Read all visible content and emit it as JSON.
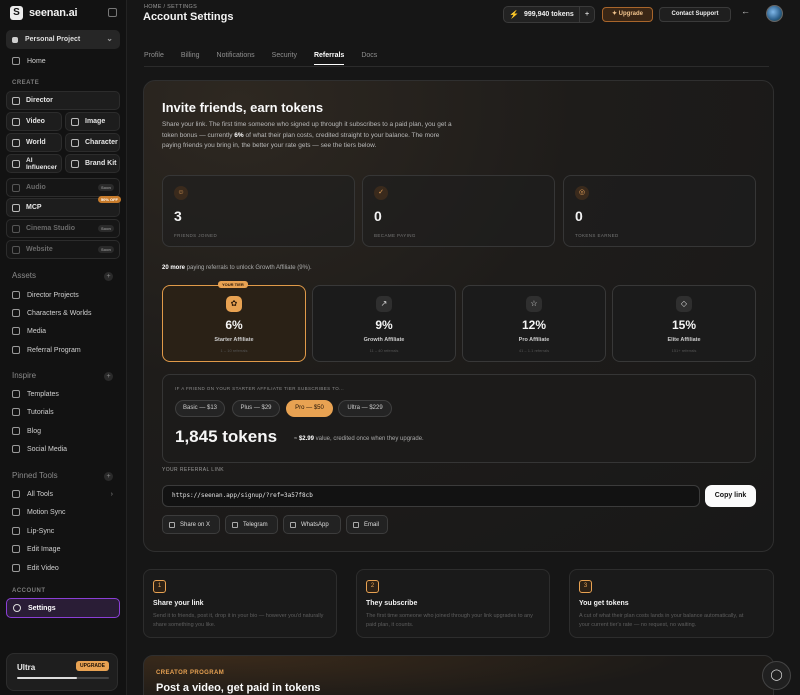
{
  "app": {
    "name": "seenan.ai"
  },
  "sidebar": {
    "project": "Personal Project",
    "home": "Home",
    "create_label": "CREATE",
    "tools": {
      "director": "Director",
      "video": "Video",
      "image": "Image",
      "world": "World",
      "character": "Character",
      "ai_influencer": "AI Influencer",
      "brand_kit": "Brand Kit",
      "audio": "Audio",
      "mcp": "MCP",
      "cinema_studio": "Cinema Studio",
      "website": "Website",
      "soon": "Soon",
      "off_badge": "50% OFF"
    },
    "assets_title": "Assets",
    "assets": [
      "Director Projects",
      "Characters & Worlds",
      "Media",
      "Referral Program"
    ],
    "inspire_title": "Inspire",
    "inspire": [
      "Templates",
      "Tutorials",
      "Blog",
      "Social Media"
    ],
    "pinned_title": "Pinned Tools",
    "pinned": [
      "All Tools",
      "Motion Sync",
      "Lip-Sync",
      "Edit Image",
      "Edit Video"
    ],
    "account_label": "ACCOUNT",
    "settings": "Settings",
    "plan": {
      "name": "Ultra",
      "upgrade": "UPGRADE",
      "usage_fraction": 0.65
    }
  },
  "header": {
    "breadcrumb": "HOME / SETTINGS",
    "title": "Account Settings",
    "tokens": "999,940 tokens",
    "upgrade": "Upgrade",
    "support": "Contact Support"
  },
  "tabs": [
    "Profile",
    "Billing",
    "Notifications",
    "Security",
    "Referrals",
    "Docs"
  ],
  "active_tab": "Referrals",
  "referral": {
    "title": "Invite friends, earn tokens",
    "desc_pre": "Share your link. The first time someone who signed up through it subscribes to a paid plan, you get a token bonus — currently ",
    "desc_pct": "6%",
    "desc_post": " of what their plan costs, credited straight to your balance. The more paying friends you bring in, the better your rate gets — see the tiers below.",
    "stats": [
      {
        "value": "3",
        "label": "FRIENDS JOINED",
        "icon": "users-icon"
      },
      {
        "value": "0",
        "label": "BECAME PAYING",
        "icon": "check-circle-icon"
      },
      {
        "value": "0",
        "label": "TOKENS EARNED",
        "icon": "coin-icon"
      }
    ],
    "unlock_strong": "20 more",
    "unlock_rest": " paying referrals to unlock Growth Affiliate (9%).",
    "your_tier": "YOUR TIER",
    "tiers": [
      {
        "pct": "6%",
        "name": "Starter Affiliate",
        "range": "1 – 10 referrals"
      },
      {
        "pct": "9%",
        "name": "Growth Affiliate",
        "range": "11 – 40 referrals"
      },
      {
        "pct": "12%",
        "name": "Pro Affiliate",
        "range": "41 – 1.1 referrals"
      },
      {
        "pct": "15%",
        "name": "Elite Affiliate",
        "range": "151+ referrals"
      }
    ],
    "calc_label": "IF A FRIEND ON YOUR STARTER AFFILIATE TIER SUBSCRIBES TO...",
    "plans": [
      "Basic — $13",
      "Plus — $29",
      "Pro — $50",
      "Ultra — $229"
    ],
    "selected_plan": "Pro — $50",
    "calc_tokens": "1,845 tokens",
    "calc_value_prefix": "≈ ",
    "calc_value_amount": "$2.99",
    "calc_value_suffix": " value, credited once when they upgrade.",
    "link_label": "YOUR REFERRAL LINK",
    "link": "https://seenan.app/signup/?ref=3a57f8cb",
    "copy": "Copy link",
    "share": [
      "Share on X",
      "Telegram",
      "WhatsApp",
      "Email"
    ]
  },
  "steps": [
    {
      "num": "1",
      "title": "Share your link",
      "desc": "Send it to friends, post it, drop it in your bio — however you'd naturally share something you like."
    },
    {
      "num": "2",
      "title": "They subscribe",
      "desc": "The first time someone who joined through your link upgrades to any paid plan, it counts."
    },
    {
      "num": "3",
      "title": "You get tokens",
      "desc": "A cut of what their plan costs lands in your balance automatically, at your current tier's rate — no request, no waiting."
    }
  ],
  "creator": {
    "label": "CREATOR PROGRAM",
    "title": "Post a video, get paid in tokens"
  },
  "colors": {
    "accent": "#e8a252",
    "active_border": "#8b3fd6"
  }
}
